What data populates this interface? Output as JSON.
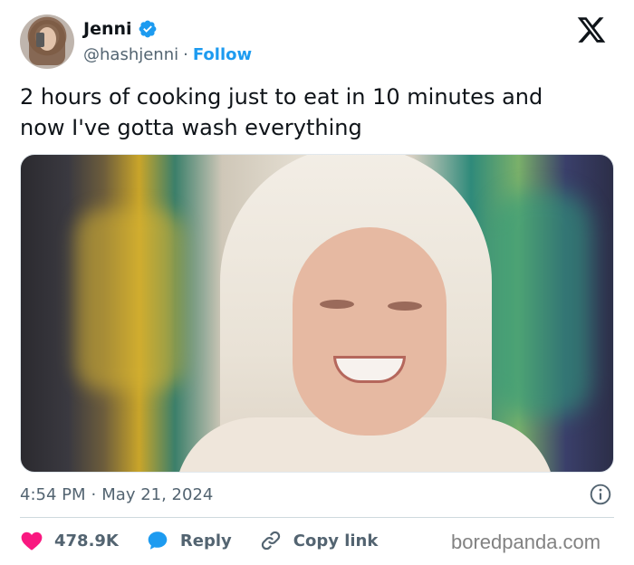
{
  "author": {
    "display_name": "Jenni",
    "handle": "@hashjenni",
    "separator": "·",
    "follow_label": "Follow"
  },
  "tweet": {
    "text": "2 hours of cooking just to eat in 10 minutes and\nnow I've gotta wash everything"
  },
  "meta": {
    "time": "4:54 PM",
    "separator": "·",
    "date": "May 21, 2024"
  },
  "actions": {
    "likes": "478.9K",
    "reply_label": "Reply",
    "copy_link_label": "Copy link"
  },
  "watermark": "boredpanda.com",
  "icons": {
    "verified": "verified-badge-icon",
    "x_logo": "x-logo-icon",
    "info": "info-icon",
    "like": "heart-icon",
    "reply": "speech-bubble-icon",
    "link": "link-icon"
  },
  "colors": {
    "accent": "#1d9bf0",
    "like": "#f91880",
    "muted_text": "#536471",
    "text": "#0f1419"
  }
}
